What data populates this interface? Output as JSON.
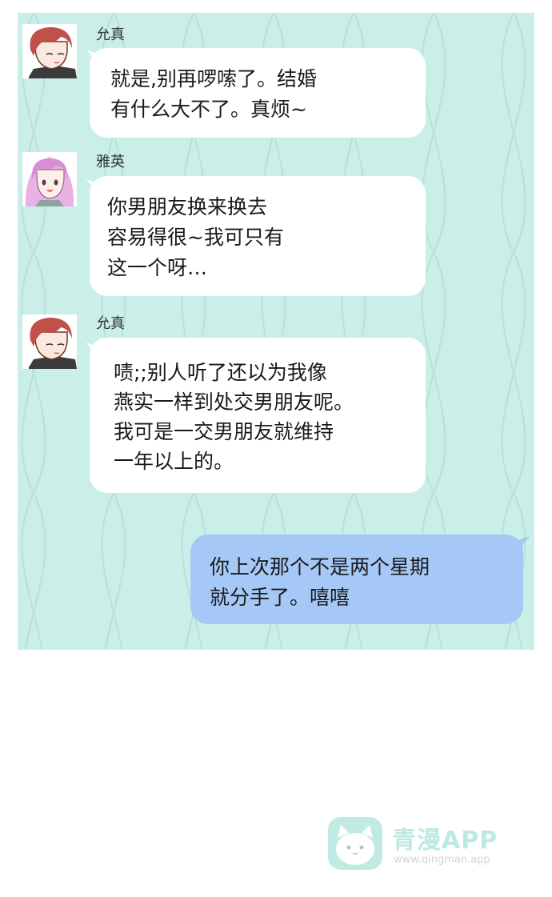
{
  "messages": [
    {
      "sender": "允真",
      "text": "就是,别再啰嗦了。结婚\n有什么大不了。真烦~",
      "avatar": "yunzhen-avatar"
    },
    {
      "sender": "雅英",
      "text": "你男朋友换来换去\n容易得很~我可只有\n这一个呀…",
      "avatar": "yaying-avatar"
    },
    {
      "sender": "允真",
      "text": "啧;;别人听了还以为我像\n燕实一样到处交男朋友呢。\n我可是一交男朋友就维持\n一年以上的。",
      "avatar": "yunzhen-avatar"
    },
    {
      "text": "你上次那个不是两个星期\n就分手了。嘻嘻"
    }
  ],
  "watermark": {
    "title": "青漫APP",
    "url": "www.qingman.app"
  },
  "colors": {
    "chat_bg": "#c9efe8",
    "bubble_other": "#ffffff",
    "bubble_self": "#a5c8f7"
  }
}
